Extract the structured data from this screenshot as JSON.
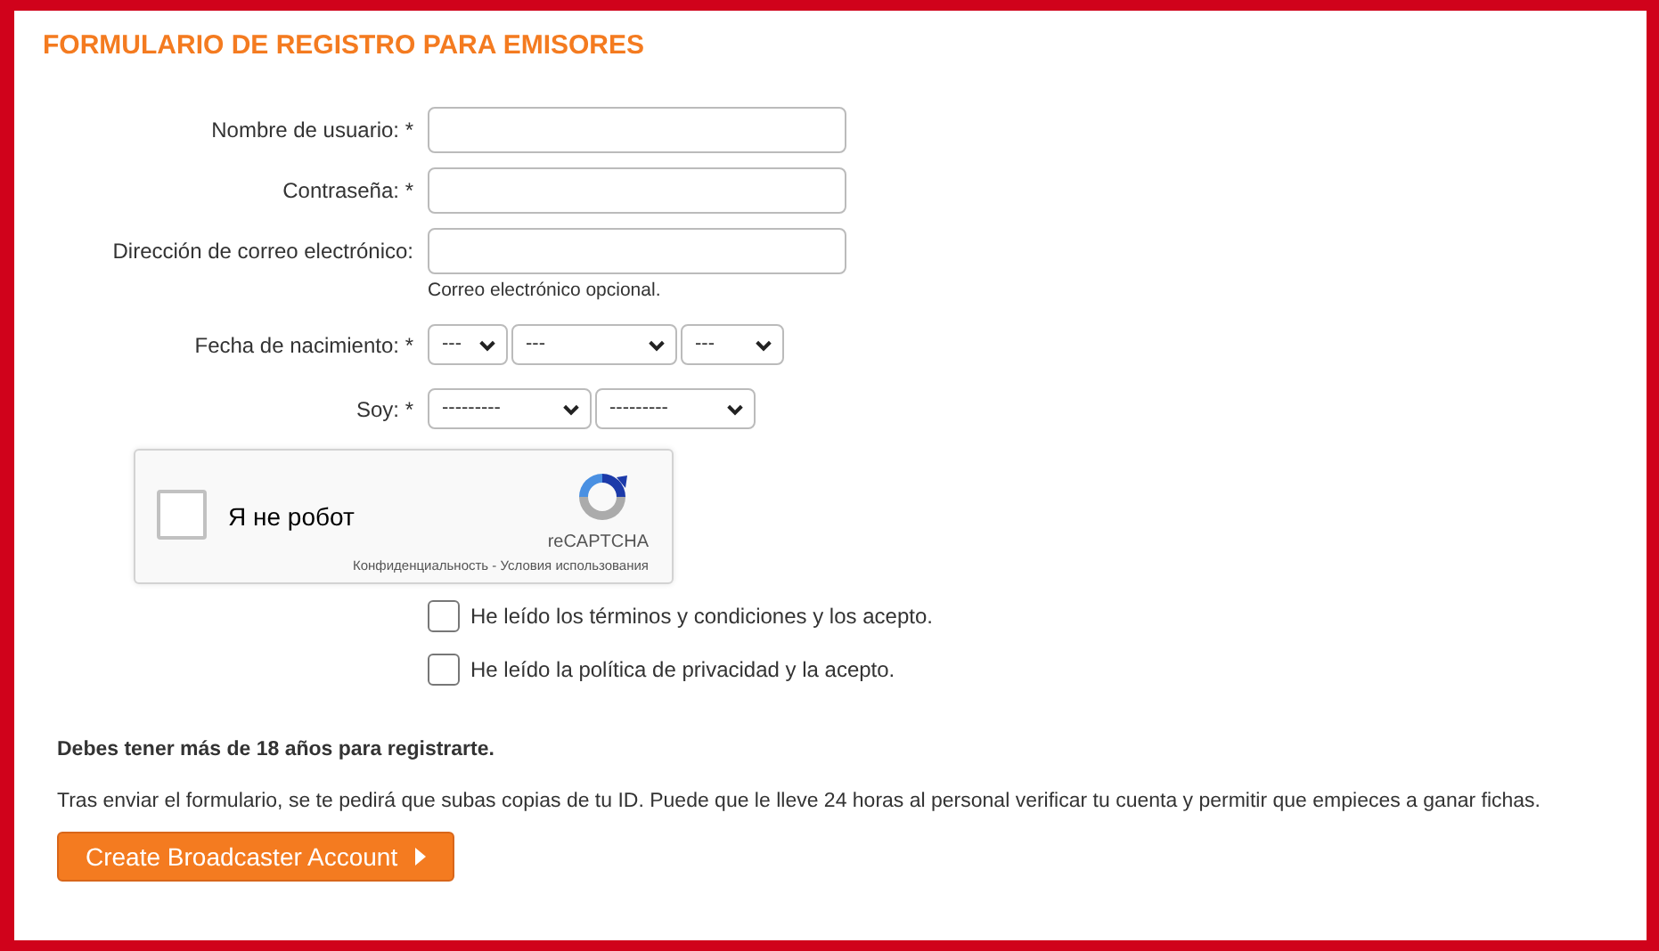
{
  "title": "FORMULARIO DE REGISTRO PARA EMISORES",
  "fields": [
    {
      "label": "Nombre de usuario: *"
    },
    {
      "label": "Contraseña: *"
    },
    {
      "label": "Dirección de correo electrónico:",
      "help": "Correo electrónico opcional."
    }
  ],
  "birth_date": {
    "label": "Fecha de nacimiento: *",
    "selects": [
      "---",
      "---",
      "---"
    ]
  },
  "gender": {
    "label": "Soy: *",
    "selects": [
      "---------",
      "---------"
    ]
  },
  "captcha": {
    "label": "Я не робот",
    "checked": false,
    "brand": "reCAPTCHA",
    "links": "Конфиденциальность - Условия использования"
  },
  "agreements": [
    {
      "label": "He leído los términos y condiciones y los acepto.",
      "checked": false
    },
    {
      "label": "He leído la política de privacidad y la acepto.",
      "checked": false
    }
  ],
  "age_notice": "Debes tener más de 18 años para registrarte.",
  "info": "Tras enviar el formulario, se te pedirá que subas copias de tu ID. Puede que le lleve 24 horas al personal verificar tu cuenta y permitir que empieces a ganar fichas.",
  "submit_button": "Create Broadcaster Account"
}
